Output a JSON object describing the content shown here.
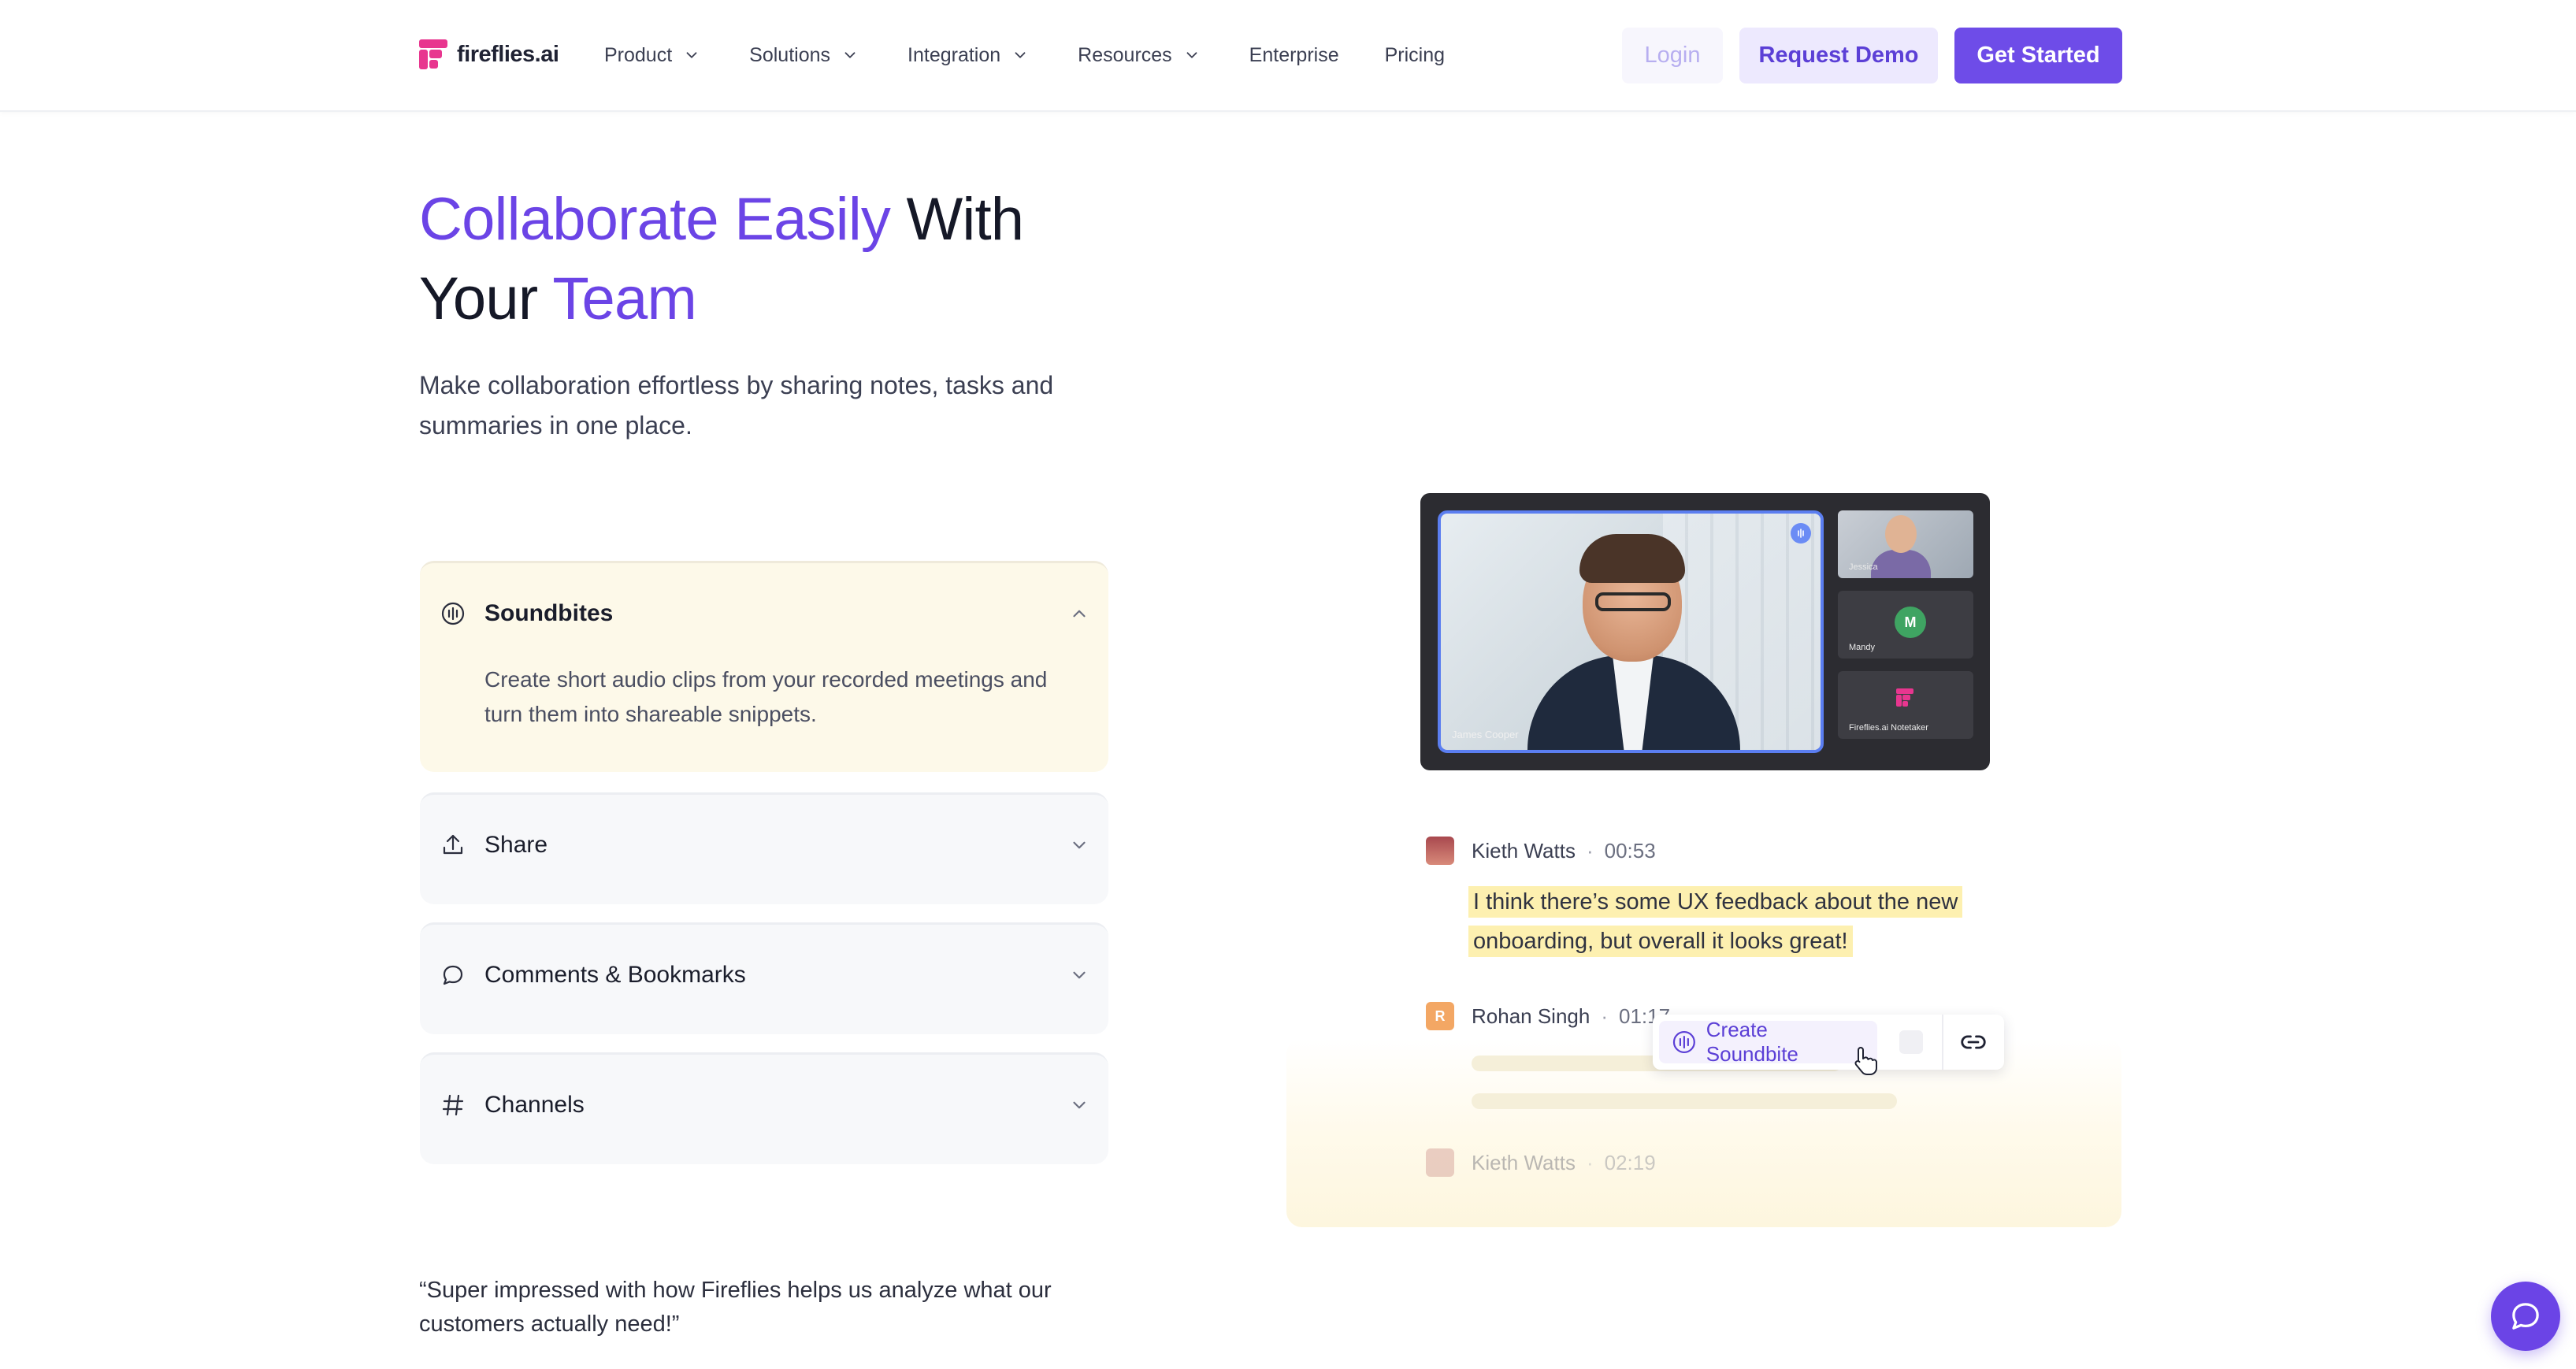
{
  "brand": {
    "name": "fireflies.ai",
    "accent": "#6b44e6",
    "logo_color": "#e8368f"
  },
  "nav": {
    "items": [
      {
        "label": "Product",
        "has_dropdown": true
      },
      {
        "label": "Solutions",
        "has_dropdown": true
      },
      {
        "label": "Integration",
        "has_dropdown": true
      },
      {
        "label": "Resources",
        "has_dropdown": true
      },
      {
        "label": "Enterprise",
        "has_dropdown": false
      },
      {
        "label": "Pricing",
        "has_dropdown": false
      }
    ],
    "login": "Login",
    "request_demo": "Request Demo",
    "get_started": "Get Started"
  },
  "hero": {
    "title_accent_1": "Collaborate Easily",
    "title_plain_1": " With",
    "title_plain_2": "Your ",
    "title_accent_2": "Team",
    "subtitle": "Make collaboration effortless by sharing notes, tasks and summaries in one place."
  },
  "features": [
    {
      "title": "Soundbites",
      "icon": "soundbite-icon",
      "expanded": true,
      "description": "Create short audio clips from your recorded meetings and turn them into shareable snippets."
    },
    {
      "title": "Share",
      "icon": "share-icon",
      "expanded": false
    },
    {
      "title": "Comments & Bookmarks",
      "icon": "comment-icon",
      "expanded": false
    },
    {
      "title": "Channels",
      "icon": "hash-icon",
      "expanded": false
    }
  ],
  "quote": "“Super impressed with how Fireflies helps us analyze what our customers actually need!”",
  "video_call": {
    "main_participant": "James Cooper",
    "participants": [
      {
        "name": "Jessica"
      },
      {
        "name": "Mandy",
        "initial": "M"
      },
      {
        "name": "Fireflies.ai Notetaker"
      }
    ]
  },
  "transcript": {
    "entries": [
      {
        "speaker": "Kieth Watts",
        "time": "00:53",
        "text": "I think there’s some UX feedback about the new onboarding, but overall it looks great!"
      },
      {
        "speaker": "Rohan Singh",
        "initial": "R",
        "time": "01:17"
      },
      {
        "speaker": "Kieth Watts",
        "time": "02:19"
      }
    ],
    "separator": "·",
    "toolbar": {
      "create_soundbite": "Create Soundbite",
      "icon": "link-icon"
    }
  },
  "chat_widget": {
    "icon": "chat-icon"
  }
}
